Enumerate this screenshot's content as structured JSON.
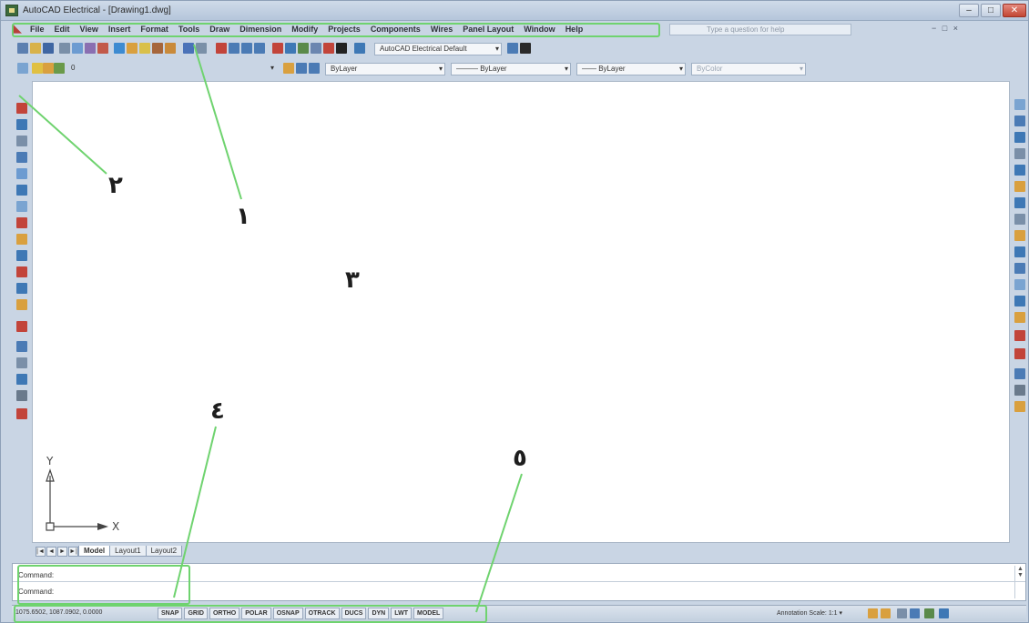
{
  "window": {
    "title": "AutoCAD Electrical - [Drawing1.dwg]",
    "controls": [
      "–",
      "□",
      "✕"
    ]
  },
  "menubar": {
    "logo": "◣",
    "items": [
      "File",
      "Edit",
      "View",
      "Insert",
      "Format",
      "Tools",
      "Draw",
      "Dimension",
      "Modify",
      "Projects",
      "Components",
      "Wires",
      "Panel Layout",
      "Window",
      "Help"
    ],
    "help_placeholder": "Type a question for help",
    "right_controls": "− □ ×"
  },
  "toolbar1": {
    "workspace_combo": "AutoCAD Electrical Default"
  },
  "toolbar2": {
    "layer_combo": "0",
    "color_combo": "ByLayer",
    "linetype_combo": "——— ByLayer",
    "lineweight_combo": "—— ByLayer",
    "plotstyle_combo": "ByColor"
  },
  "layout_tabs": {
    "nav": [
      "|◄",
      "◄",
      "►",
      "►|"
    ],
    "tabs": [
      "Model",
      "Layout1",
      "Layout2"
    ]
  },
  "command": {
    "line1": "Command:",
    "line2": "Command:"
  },
  "statusbar": {
    "coords": "1075.6502, 1087.0902, 0.0000",
    "toggles": [
      "SNAP",
      "GRID",
      "ORTHO",
      "POLAR",
      "OSNAP",
      "OTRACK",
      "DUCS",
      "DYN",
      "LWT",
      "MODEL"
    ],
    "annotation_scale": "Annotation Scale: 1:1 ▾"
  },
  "ucs": {
    "x_label": "X",
    "y_label": "Y"
  },
  "callouts": {
    "n1": "١",
    "n2": "٢",
    "n3": "٣",
    "n4": "٤",
    "n5": "٥"
  },
  "colors": {
    "callout_green": "#6fd36f",
    "title_bar": "#c5d3e4",
    "close_red": "#c24633"
  }
}
